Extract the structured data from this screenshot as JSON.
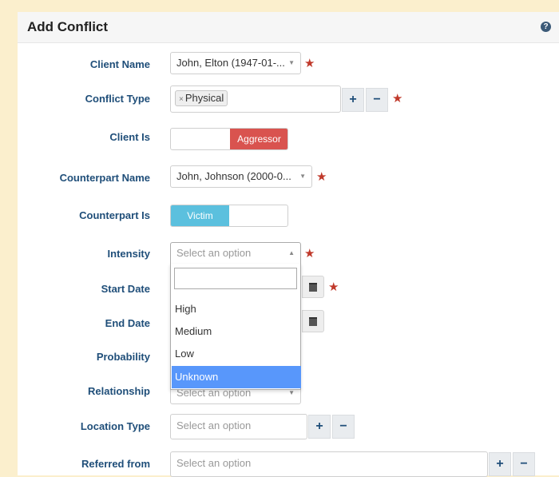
{
  "header": {
    "title": "Add Conflict",
    "help_icon": "question-circle-icon"
  },
  "colors": {
    "required": "#c0392b",
    "aggressor": "#d9534f",
    "victim": "#5bc0de",
    "highlight": "#5897fb",
    "label": "#1f4e79"
  },
  "fields": {
    "client_name": {
      "label": "Client Name",
      "value": "John, Elton (1947-01-..."
    },
    "conflict_type": {
      "label": "Conflict Type",
      "tags": [
        "Physical"
      ],
      "tag_remove": "×",
      "add": "+",
      "remove": "−"
    },
    "client_is": {
      "label": "Client Is",
      "selected": "Aggressor"
    },
    "counterpart_name": {
      "label": "Counterpart Name",
      "value": "John, Johnson (2000-0..."
    },
    "counterpart_is": {
      "label": "Counterpart Is",
      "selected": "Victim"
    },
    "intensity": {
      "label": "Intensity",
      "placeholder": "Select an option",
      "search_value": "",
      "options": [
        "High",
        "Medium",
        "Low",
        "Unknown"
      ],
      "highlighted": "Unknown"
    },
    "start_date": {
      "label": "Start Date"
    },
    "end_date": {
      "label": "End Date"
    },
    "probability": {
      "label": "Probability"
    },
    "relationship": {
      "label": "Relationship",
      "placeholder": "Select an option"
    },
    "location_type": {
      "label": "Location Type",
      "placeholder": "Select an option",
      "add": "+",
      "remove": "−"
    },
    "referred_from": {
      "label": "Referred from",
      "placeholder": "Select an option",
      "add": "+",
      "remove": "−"
    }
  },
  "icons": {
    "calendar": "calendar-icon",
    "dropdown": "caret-down-icon",
    "required": "asterisk-icon"
  },
  "glyphs": {
    "caret_down": "▼",
    "caret_up": "▲",
    "star": "★"
  }
}
